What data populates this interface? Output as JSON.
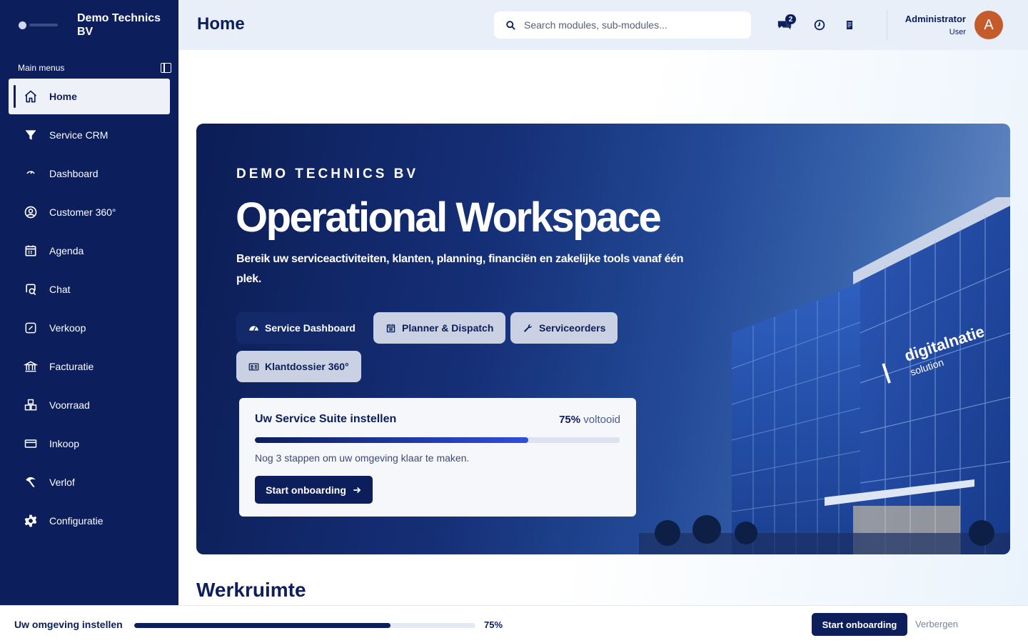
{
  "app": {
    "company": "Demo Technics BV"
  },
  "sidebar": {
    "section_label": "Main menus",
    "items": [
      {
        "label": "Home",
        "icon": "home-icon",
        "active": true
      },
      {
        "label": "Service CRM",
        "icon": "funnel-icon"
      },
      {
        "label": "Dashboard",
        "icon": "gauge-icon"
      },
      {
        "label": "Customer 360°",
        "icon": "user-circle-icon"
      },
      {
        "label": "Agenda",
        "icon": "calendar-icon"
      },
      {
        "label": "Chat",
        "icon": "chat-icon"
      },
      {
        "label": "Verkoop",
        "icon": "sales-icon"
      },
      {
        "label": "Facturatie",
        "icon": "bank-icon"
      },
      {
        "label": "Voorraad",
        "icon": "boxes-icon"
      },
      {
        "label": "Inkoop",
        "icon": "card-icon"
      },
      {
        "label": "Verlof",
        "icon": "leave-icon"
      },
      {
        "label": "Configuratie",
        "icon": "gear-icon"
      }
    ]
  },
  "header": {
    "title": "Home",
    "search_placeholder": "Search modules, sub-modules...",
    "chat_badge": "2",
    "user_name": "Administrator",
    "user_role": "User",
    "avatar_letter": "A"
  },
  "hero": {
    "eyebrow": "DEMO TECHNICS BV",
    "title": "Operational Workspace",
    "subtitle": "Bereik uw serviceactiviteiten, klanten, planning, financiën en zakelijke tools vanaf één plek.",
    "buttons": [
      {
        "label": "Service Dashboard",
        "icon": "gauge-icon",
        "style": "dark"
      },
      {
        "label": "Planner & Dispatch",
        "icon": "calendar-icon",
        "style": "light"
      },
      {
        "label": "Serviceorders",
        "icon": "wrench-icon",
        "style": "light"
      },
      {
        "label": "Klantdossier 360°",
        "icon": "id-card-icon",
        "style": "light"
      }
    ],
    "building_sign": [
      "digitalnatie",
      "solution"
    ]
  },
  "suite": {
    "title": "Uw Service Suite instellen",
    "percent_text": "75%",
    "percent_suffix": "voltooid",
    "progress": 0.75,
    "note": "Nog 3 stappen om uw omgeving klaar te maken.",
    "button": "Start onboarding"
  },
  "section_title": "Werkruimte",
  "bottom_bar": {
    "label": "Uw omgeving instellen",
    "progress": 0.75,
    "percent_text": "75%",
    "start_button": "Start onboarding",
    "hide_button": "Verbergen"
  },
  "colors": {
    "navy": "#0c1e5b",
    "accent": "#2f4de0",
    "avatar": "#c55a2b"
  }
}
